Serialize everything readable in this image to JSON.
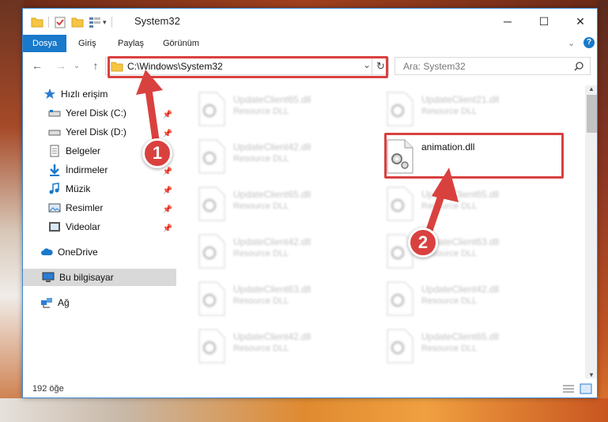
{
  "window": {
    "title": "System32",
    "minimize": "─",
    "maximize": "☐",
    "close": "✕"
  },
  "ribbon": {
    "tabs": [
      "Dosya",
      "Giriş",
      "Paylaş",
      "Görünüm"
    ],
    "help": "?"
  },
  "nav": {
    "back": "←",
    "forward": "→",
    "recent": "⌄",
    "up": "↑",
    "address": "C:\\Windows\\System32",
    "search_placeholder": "Ara: System32"
  },
  "sidebar": {
    "quick_access": "Hızlı erişim",
    "items": [
      {
        "label": "Yerel Disk (C:)",
        "icon": "drive-icon"
      },
      {
        "label": "Yerel Disk (D:)",
        "icon": "drive-icon"
      },
      {
        "label": "Belgeler",
        "icon": "documents-icon"
      },
      {
        "label": "İndirmeler",
        "icon": "downloads-icon"
      },
      {
        "label": "Müzik",
        "icon": "music-icon"
      },
      {
        "label": "Resimler",
        "icon": "pictures-icon"
      },
      {
        "label": "Videolar",
        "icon": "videos-icon"
      }
    ],
    "onedrive": "OneDrive",
    "this_pc": "Bu bilgisayar",
    "network": "Ağ"
  },
  "files": {
    "left_column": [
      {
        "name": "UpdateClient65.dll",
        "desc": "Resource DLL"
      },
      {
        "name": "UpdateClient42.dll",
        "desc": "Resource DLL"
      },
      {
        "name": "UpdateClient65.dll",
        "desc": "Resource DLL"
      },
      {
        "name": "UpdateClient42.dll",
        "desc": "Resource DLL"
      },
      {
        "name": "UpdateClient63.dll",
        "desc": "Resource DLL"
      },
      {
        "name": "UpdateClient42.dll",
        "desc": "Resource DLL"
      }
    ],
    "right_column": [
      {
        "name": "UpdateClient21.dll",
        "desc": "Resource DLL"
      },
      {
        "name": "animation.dll",
        "desc": ""
      },
      {
        "name": "UpdateClient65.dll",
        "desc": "Resource DLL"
      },
      {
        "name": "UpdateClient63.dll",
        "desc": "Resource DLL"
      },
      {
        "name": "UpdateClient42.dll",
        "desc": "Resource DLL"
      },
      {
        "name": "UpdateClient65.dll",
        "desc": "Resource DLL"
      }
    ]
  },
  "status": {
    "count": "192 öğe"
  },
  "markers": {
    "one": "1",
    "two": "2"
  },
  "colors": {
    "accent": "#1979ca",
    "highlight": "#d9413f"
  }
}
